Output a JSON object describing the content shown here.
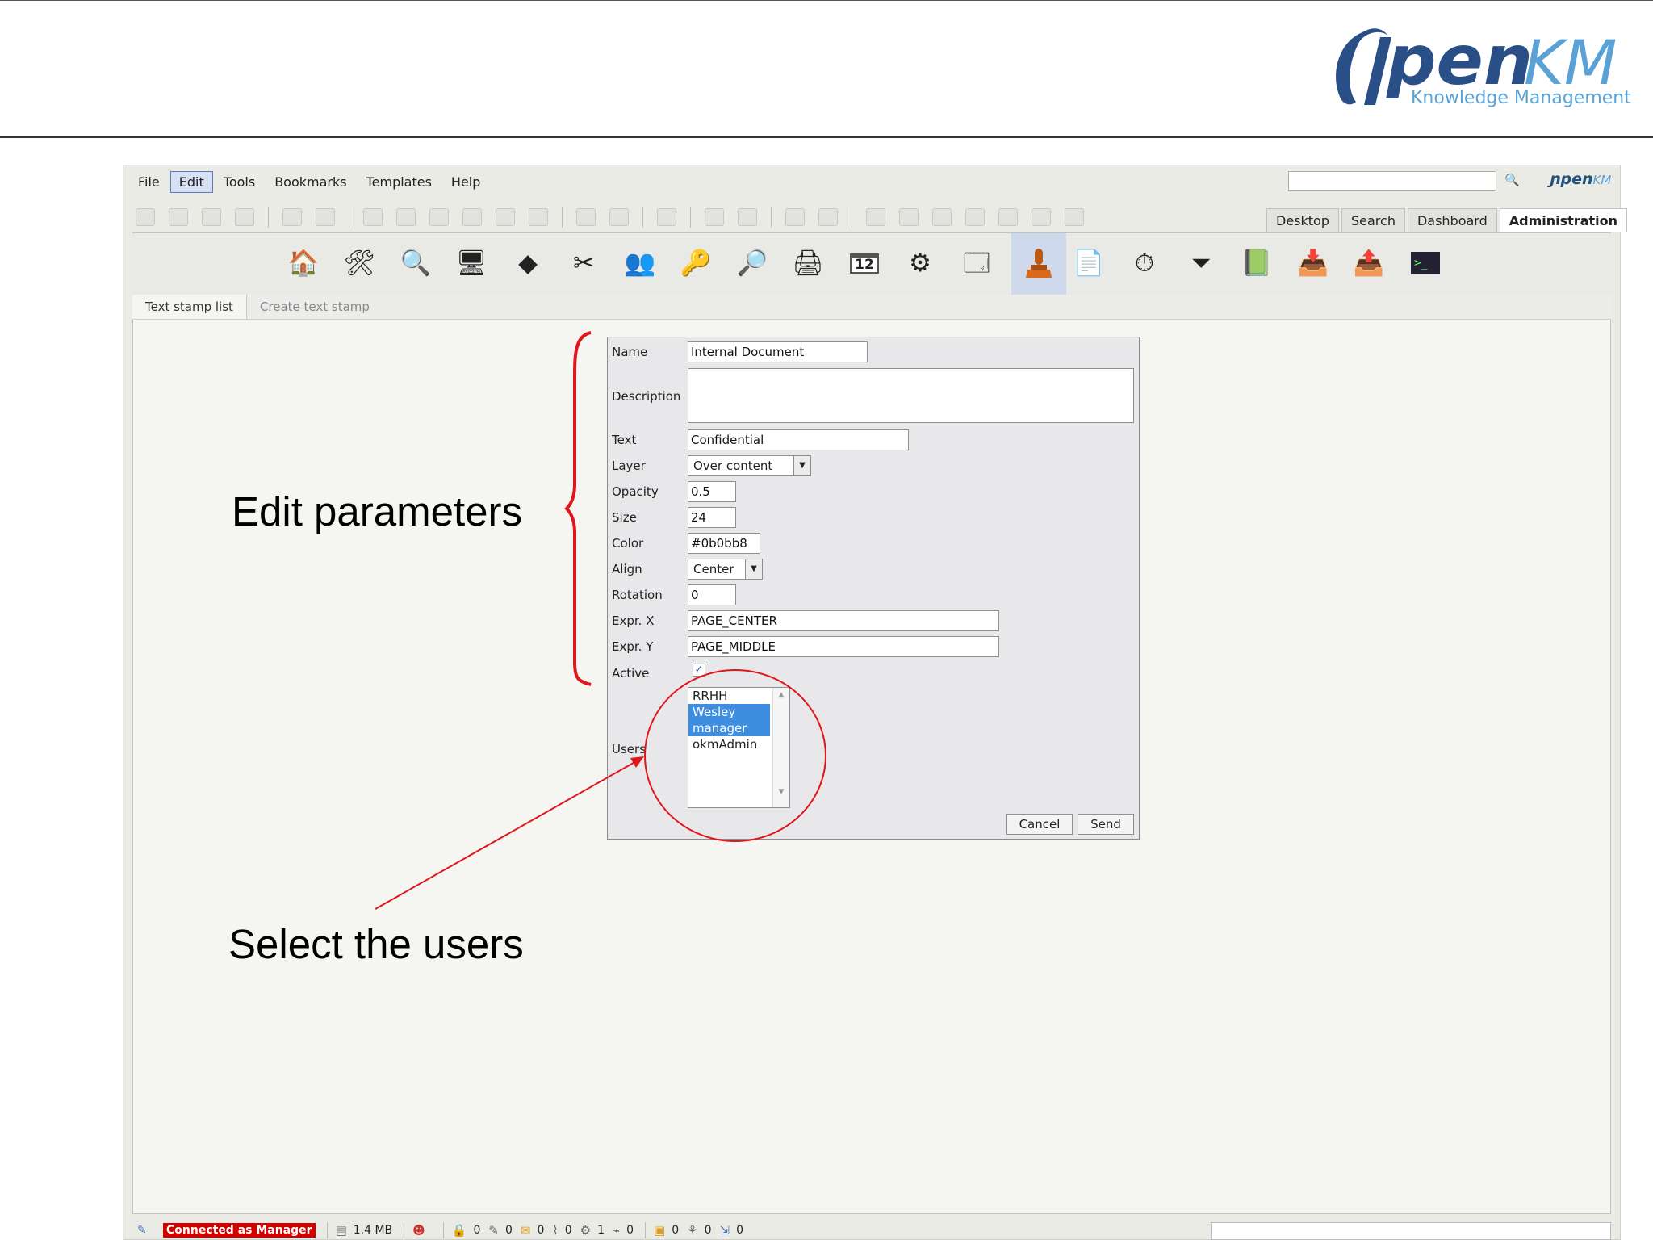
{
  "logo": {
    "brand_main": "pen",
    "brand_accent": "KM",
    "tagline": "Knowledge Management"
  },
  "menu": {
    "items": [
      "File",
      "Edit",
      "Tools",
      "Bookmarks",
      "Templates",
      "Help"
    ],
    "active": "Edit"
  },
  "header_mini_logo": {
    "main": "pen",
    "accent": "KM"
  },
  "tabs": {
    "items": [
      "Desktop",
      "Search",
      "Dashboard",
      "Administration"
    ],
    "active": "Administration"
  },
  "admin_toolbar_icons": [
    "home-icon",
    "tools-icon",
    "search-document-icon",
    "monitor-icon",
    "diamond-icon",
    "scissors-icon",
    "users-icon",
    "keys-icon",
    "magnifier-icon",
    "printer-icon",
    "calendar-icon",
    "gear-icon",
    "window-icon",
    "stamp-icon",
    "clock-document-icon",
    "stopwatch-icon",
    "funnel-icon",
    "book-icon",
    "download-icon",
    "upload-icon",
    "terminal-icon"
  ],
  "admin_toolbar_glyphs": [
    "🏠",
    "🛠",
    "🔍",
    "🖥",
    "◆",
    "✂",
    "👥",
    "🔑",
    "🔎",
    "🖨",
    "📅",
    "⚙",
    "🗔",
    "⛭",
    "📄",
    "⏱",
    "⏷",
    "📗",
    "📥",
    "📤",
    "▶"
  ],
  "calendar_day": "12",
  "subtabs": {
    "list": "Text stamp list",
    "create": "Create text stamp"
  },
  "form": {
    "name_label": "Name",
    "name_value": "Internal Document",
    "description_label": "Description",
    "description_value": "",
    "text_label": "Text",
    "text_value": "Confidential",
    "layer_label": "Layer",
    "layer_value": "Over content",
    "opacity_label": "Opacity",
    "opacity_value": "0.5",
    "size_label": "Size",
    "size_value": "24",
    "color_label": "Color",
    "color_value": "#0b0bb8",
    "align_label": "Align",
    "align_value": "Center",
    "rotation_label": "Rotation",
    "rotation_value": "0",
    "exprx_label": "Expr. X",
    "exprx_value": "PAGE_CENTER",
    "expry_label": "Expr. Y",
    "expry_value": "PAGE_MIDDLE",
    "active_label": "Active",
    "active_checked": true,
    "users_label": "Users",
    "users": [
      {
        "name": "RRHH",
        "selected": false
      },
      {
        "name": "Wesley",
        "selected": true
      },
      {
        "name": "manager",
        "selected": true
      },
      {
        "name": "okmAdmin",
        "selected": false
      }
    ],
    "cancel_label": "Cancel",
    "send_label": "Send"
  },
  "annotations": {
    "edit_note": "Edit parameters",
    "select_note": "Select the users",
    "color": "#e0161c"
  },
  "status": {
    "connected": "Connected as Manager",
    "quota": "1.4 MB",
    "counters": [
      {
        "icon": "lock-icon",
        "value": "0"
      },
      {
        "icon": "edit-icon",
        "value": "0"
      },
      {
        "icon": "mail-icon",
        "value": "0"
      },
      {
        "icon": "clip-icon",
        "value": "0"
      },
      {
        "icon": "gear-icon",
        "value": "1"
      },
      {
        "icon": "tag-icon",
        "value": "0"
      },
      {
        "icon": "folder-green-icon",
        "value": "0"
      },
      {
        "icon": "group-icon",
        "value": "0"
      },
      {
        "icon": "doc-arrow-icon",
        "value": "0"
      }
    ]
  }
}
